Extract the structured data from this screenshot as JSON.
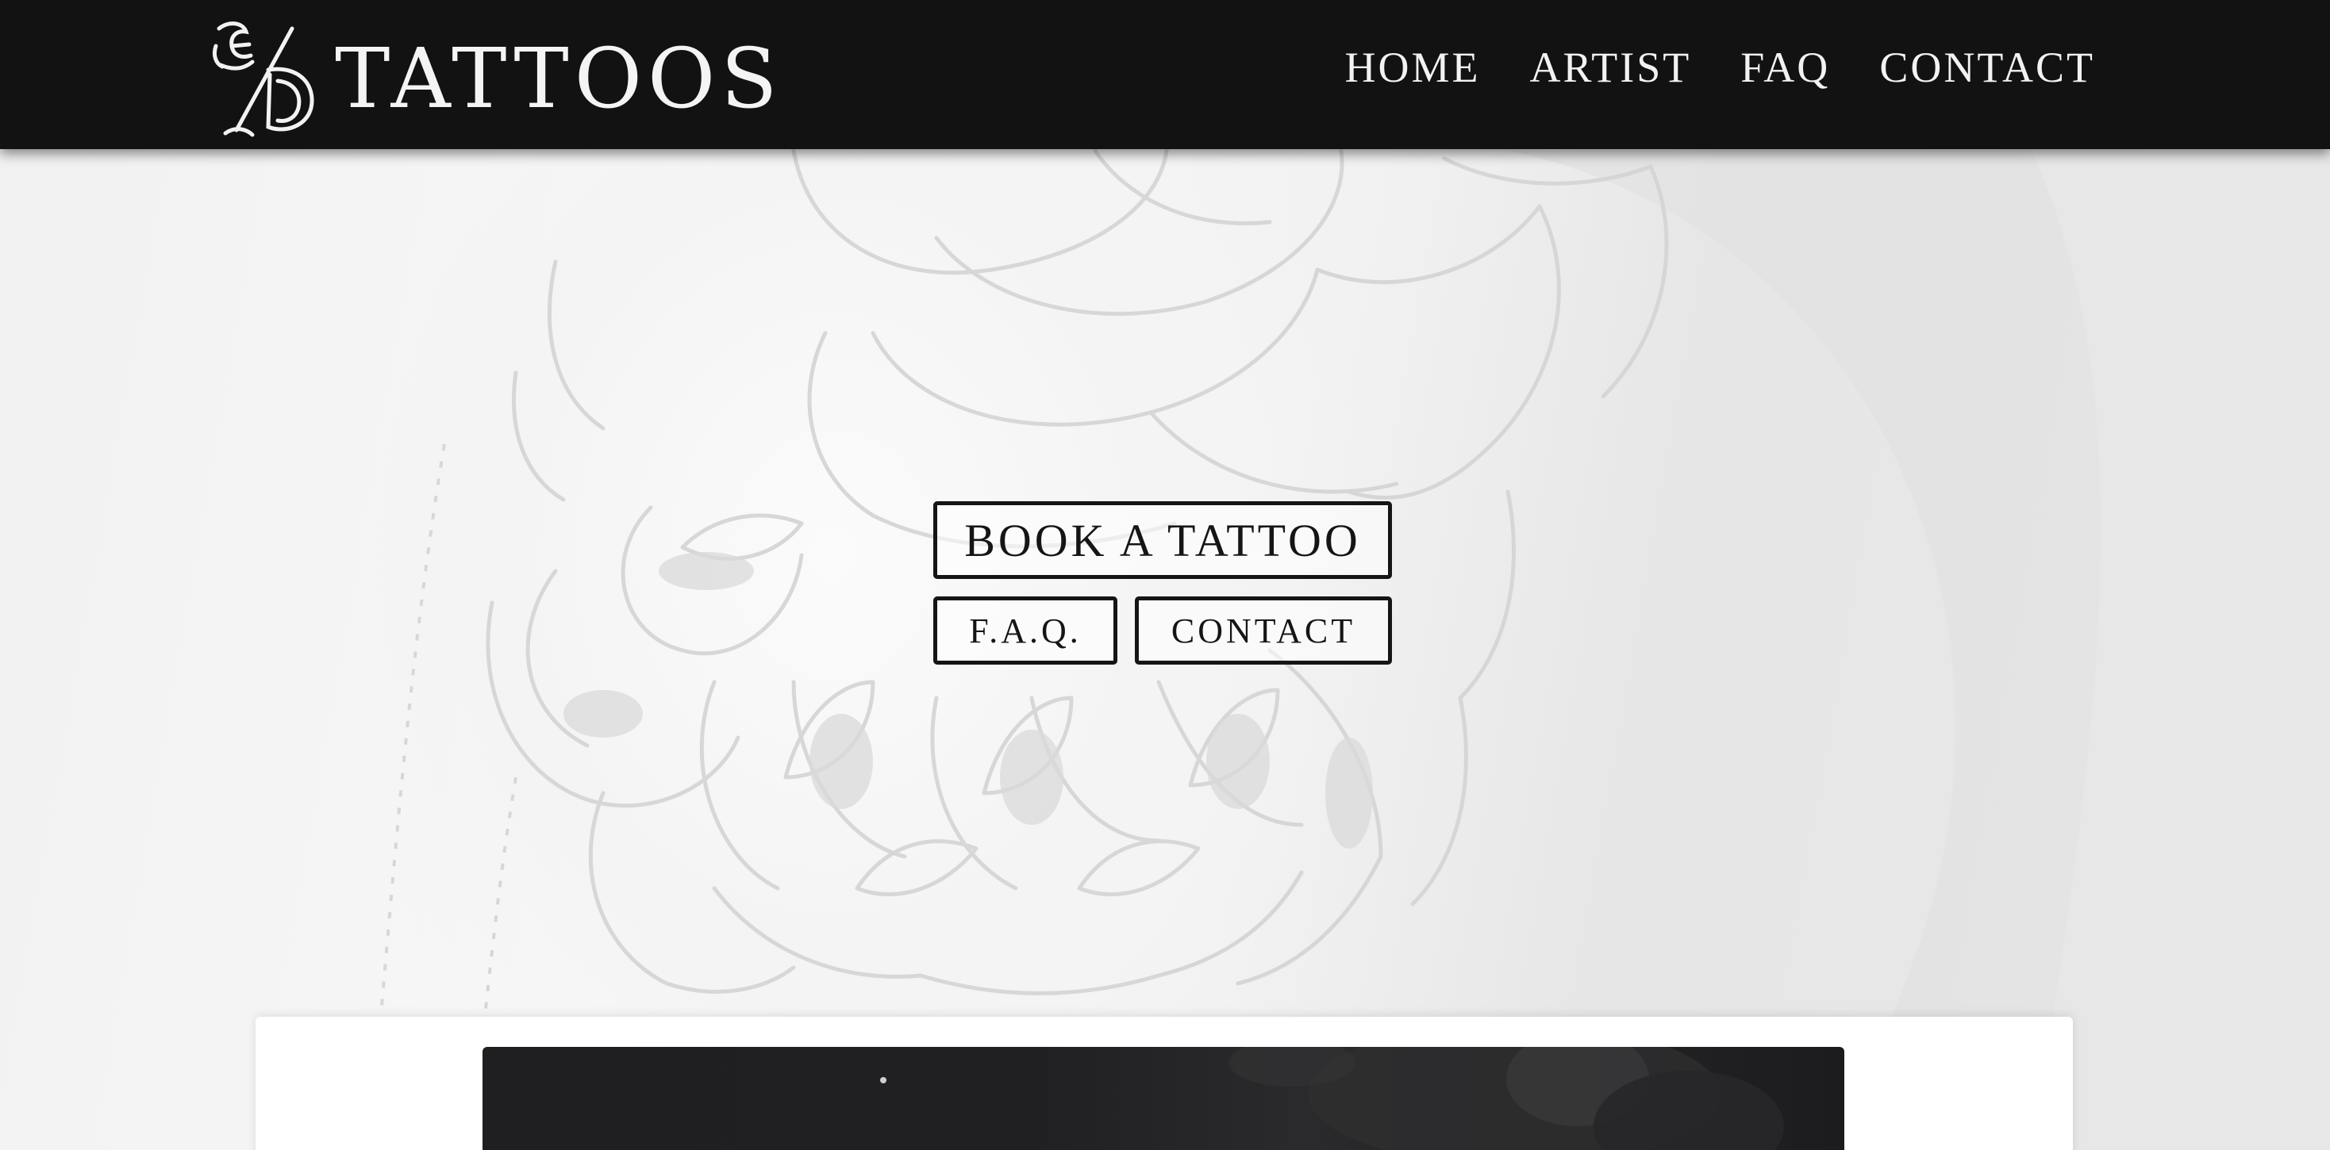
{
  "brand": {
    "monogram": "E/D",
    "name": "TATTOOS"
  },
  "nav": {
    "items": [
      {
        "label": "HOME"
      },
      {
        "label": "ARTIST"
      },
      {
        "label": "FAQ"
      },
      {
        "label": "CONTACT"
      }
    ]
  },
  "hero": {
    "book_button": "BOOK A TATTOO",
    "faq_button": "F.A.Q.",
    "contact_button": "CONTACT"
  },
  "colors": {
    "navbar": "#121212",
    "nav_text": "#f2f2f2",
    "button_border": "#151515",
    "hero_background": "#f2f2f2",
    "card": "#ffffff"
  }
}
